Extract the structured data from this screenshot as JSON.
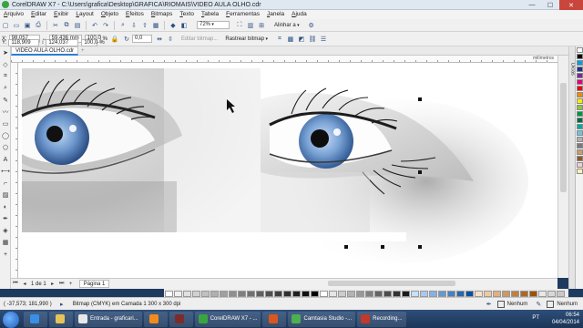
{
  "window": {
    "title": "CorelDRAW X7 - C:\\Users\\grafica\\Desktop\\GRAFICA\\RIOMAIS\\VIDEO AULA OLHO.cdr",
    "minimize": "—",
    "maximize": "☐",
    "close": "✕"
  },
  "menu": [
    "Arquivo",
    "Editar",
    "Exibir",
    "Layout",
    "Objeto",
    "Efeitos",
    "Bitmaps",
    "Texto",
    "Tabela",
    "Ferramentas",
    "Janela",
    "Ajuda"
  ],
  "toolbar1": {
    "zoom": "72%",
    "align_label": "Alinhar a"
  },
  "toolbar2": {
    "x": "98,057 mm",
    "y": "118,909 mm",
    "w": "59,436 mm",
    "h": "124,037 mm",
    "scale_x": "100,0",
    "scale_y": "100,0",
    "pct": "%",
    "angle": "0,0",
    "edit_bitmap": "Editar bitmap...",
    "trace_bitmap": "Rastrear bitmap"
  },
  "document_tab": "VIDEO AULA OLHO.cdr",
  "ruler_unit": "milímetros",
  "dockers_label": "Dicas",
  "page_nav": {
    "page_count": "1 de 1",
    "page_tab": "Página 1"
  },
  "status": {
    "coords": "( -37,573; 181,990 )",
    "object_info": "Bitmap (CMYK) em Camada 1 300 x 300 dpi",
    "fill": "Nenhum",
    "outline": "Nenhum"
  },
  "taskbar": {
    "tasks": [
      {
        "label": "Entrada - graficari...",
        "icon_color": "#e8e8e8"
      },
      {
        "label": "CorelDRAW X7 - ...",
        "icon_color": "#3aa540"
      },
      {
        "label": "Camtasia Studio -...",
        "icon_color": "#4caf50"
      },
      {
        "label": "Recording...",
        "icon_color": "#c0392b"
      }
    ],
    "language": "PT",
    "time": "06:54",
    "date": "04/04/2014"
  },
  "palette_colors": [
    "#ffffff",
    "#000000",
    "#00a0e0",
    "#1a2f8f",
    "#7c2a8e",
    "#e0007a",
    "#e30613",
    "#f08a00",
    "#ffed00",
    "#8cc63f",
    "#009640",
    "#006b3f",
    "#00a99d",
    "#6ec1e4",
    "#b0b0b0",
    "#7a7a7a",
    "#c8a06a",
    "#8b5a2b",
    "#f6c9d6",
    "#fdf2b0"
  ],
  "gray_ramp": [
    "#ffffff",
    "#f0f0f0",
    "#e0e0e0",
    "#d0d0d0",
    "#c0c0c0",
    "#b0b0b0",
    "#a0a0a0",
    "#909090",
    "#808080",
    "#707070",
    "#606060",
    "#505050",
    "#404040",
    "#303030",
    "#202020",
    "#101010",
    "#000000",
    "#ffffff",
    "#e6e6e6",
    "#cccccc",
    "#b3b3b3",
    "#999999",
    "#808080",
    "#666666",
    "#4d4d4d",
    "#333333",
    "#1a1a1a",
    "#c8e0f8",
    "#a8c8f0",
    "#88b0e0",
    "#6898d0",
    "#4880c0",
    "#2868b0",
    "#0850a0",
    "#f8e0c8",
    "#f0c8a0",
    "#e0b080",
    "#d09860",
    "#c08040",
    "#b06820",
    "#a05000",
    "#e8e8e8",
    "#d8d8d8",
    "#c8c8c8"
  ]
}
